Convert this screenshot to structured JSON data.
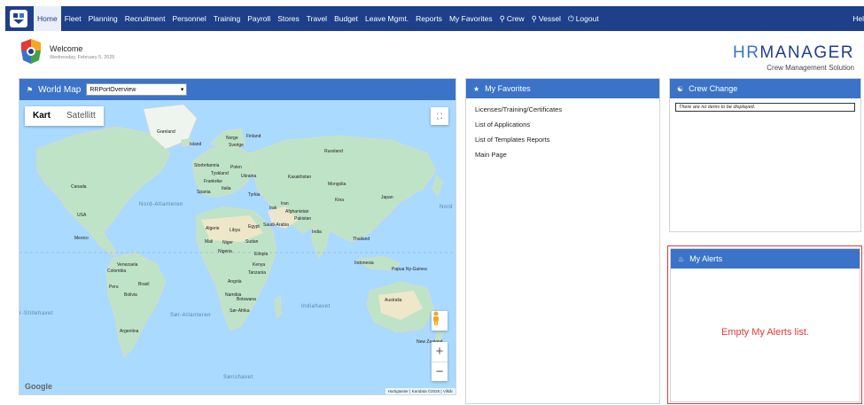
{
  "nav": {
    "items": [
      {
        "label": "Home",
        "active": true
      },
      {
        "label": "Fleet"
      },
      {
        "label": "Planning"
      },
      {
        "label": "Recruitment"
      },
      {
        "label": "Personnel"
      },
      {
        "label": "Training"
      },
      {
        "label": "Payroll"
      },
      {
        "label": "Stores"
      },
      {
        "label": "Travel"
      },
      {
        "label": "Budget"
      },
      {
        "label": "Leave Mgmt."
      },
      {
        "label": "Reports"
      },
      {
        "label": "My Favorites"
      },
      {
        "label": "Crew",
        "icon": "search-icon"
      },
      {
        "label": "Vessel",
        "icon": "search-icon"
      },
      {
        "label": "Logout",
        "icon": "power-icon"
      }
    ],
    "help": "Hel"
  },
  "header": {
    "welcome": "Welcome",
    "date": "Wednesday, February 5, 2025",
    "brand_hr": "HR",
    "brand_rest": "MANAGER",
    "brand_sub": "Crew Management Solution"
  },
  "world_map": {
    "title": "World Map",
    "icon": "map-icon",
    "select_value": "RRPortOverview",
    "toggle_map": "Kart",
    "toggle_satellite": "Satellitt",
    "google": "Google",
    "attribution": "Hurtigtaster | Kartdata ©2025 | Vilkår",
    "oceans": {
      "north_atlantic": "Nord-Atlanteren",
      "south_atlantic": "Sør-Atlanteren",
      "indian": "Indiahavet",
      "southern": "Sørishavet",
      "pacific_left": "r-Stillehavet",
      "pacific_right": "Nord"
    },
    "labels": {
      "greenland": "Grønland",
      "canada": "Canada",
      "usa": "USA",
      "mexico": "Mexico",
      "venezuela": "Venezuela",
      "colombia": "Colombia",
      "peru": "Peru",
      "brazil": "Brasil",
      "bolivia": "Bolivia",
      "argentina": "Argentina",
      "russia": "Russland",
      "finland": "Finland",
      "norway": "Norge",
      "sweden": "Sverige",
      "uk": "Storbritannia",
      "poland": "Polen",
      "germany": "Tyskland",
      "ukraine": "Ukraina",
      "france": "Frankrike",
      "spain": "Spania",
      "italy": "Italia",
      "turkey": "Tyrkia",
      "kazakhstan": "Kasakhstan",
      "mongolia": "Mongolia",
      "china": "Kina",
      "japan": "Japan",
      "iran": "Iran",
      "iraq": "Irak",
      "afghanistan": "Afghanistan",
      "pakistan": "Pakistan",
      "india": "India",
      "saudi": "Saudi-Arabia",
      "algeria": "Algerie",
      "libya": "Libya",
      "egypt": "Egypt",
      "mali": "Mali",
      "niger": "Niger",
      "sudan": "Sudan",
      "nigeria": "Nigeria",
      "ethiopia": "Etiopia",
      "kenya": "Kenya",
      "tanzania": "Tanzania",
      "angola": "Angola",
      "namibia": "Namibia",
      "botswana": "Botswana",
      "south_africa": "Sør-Afrika",
      "thailand": "Thailand",
      "indonesia": "Indonesia",
      "png": "Papua Ny-Guinea",
      "australia": "Australia",
      "nz": "New Zealand",
      "iceland": "Island"
    }
  },
  "favorites": {
    "title": "My Favorites",
    "icon": "star-icon",
    "items": [
      "Licenses/Training/Certificates",
      "List of Applications",
      "List of Templates Reports",
      "Main Page"
    ]
  },
  "crew_change": {
    "title": "Crew Change",
    "icon": "users-icon",
    "empty": "There are no items to be displayed."
  },
  "alerts": {
    "title": "My Alerts",
    "icon": "bell-icon",
    "empty": "Empty My Alerts list."
  },
  "colors": {
    "nav_bg": "#1e3f8a",
    "panel_head": "#3a73c8",
    "ocean": "#aadaff",
    "land": "#bfe3c7",
    "alert_red": "#e53935"
  }
}
